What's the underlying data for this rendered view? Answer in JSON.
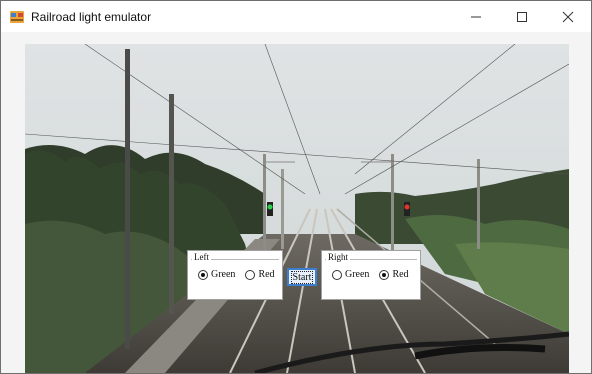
{
  "window": {
    "title": "Railroad light emulator",
    "minimize_label": "—",
    "maximize_label": "☐",
    "close_label": "✕"
  },
  "scene": {
    "description_icon": "railroad-track-photo",
    "left_signal_color": "#2bd14a",
    "right_signal_color": "#e2352c"
  },
  "left_group": {
    "title": "Left",
    "options": [
      {
        "label": "Green",
        "checked": true
      },
      {
        "label": "Red",
        "checked": false
      }
    ]
  },
  "right_group": {
    "title": "Right",
    "options": [
      {
        "label": "Green",
        "checked": false
      },
      {
        "label": "Red",
        "checked": true
      }
    ]
  },
  "start_button": {
    "label": "Start"
  },
  "colors": {
    "accent": "#3c7fd0"
  }
}
